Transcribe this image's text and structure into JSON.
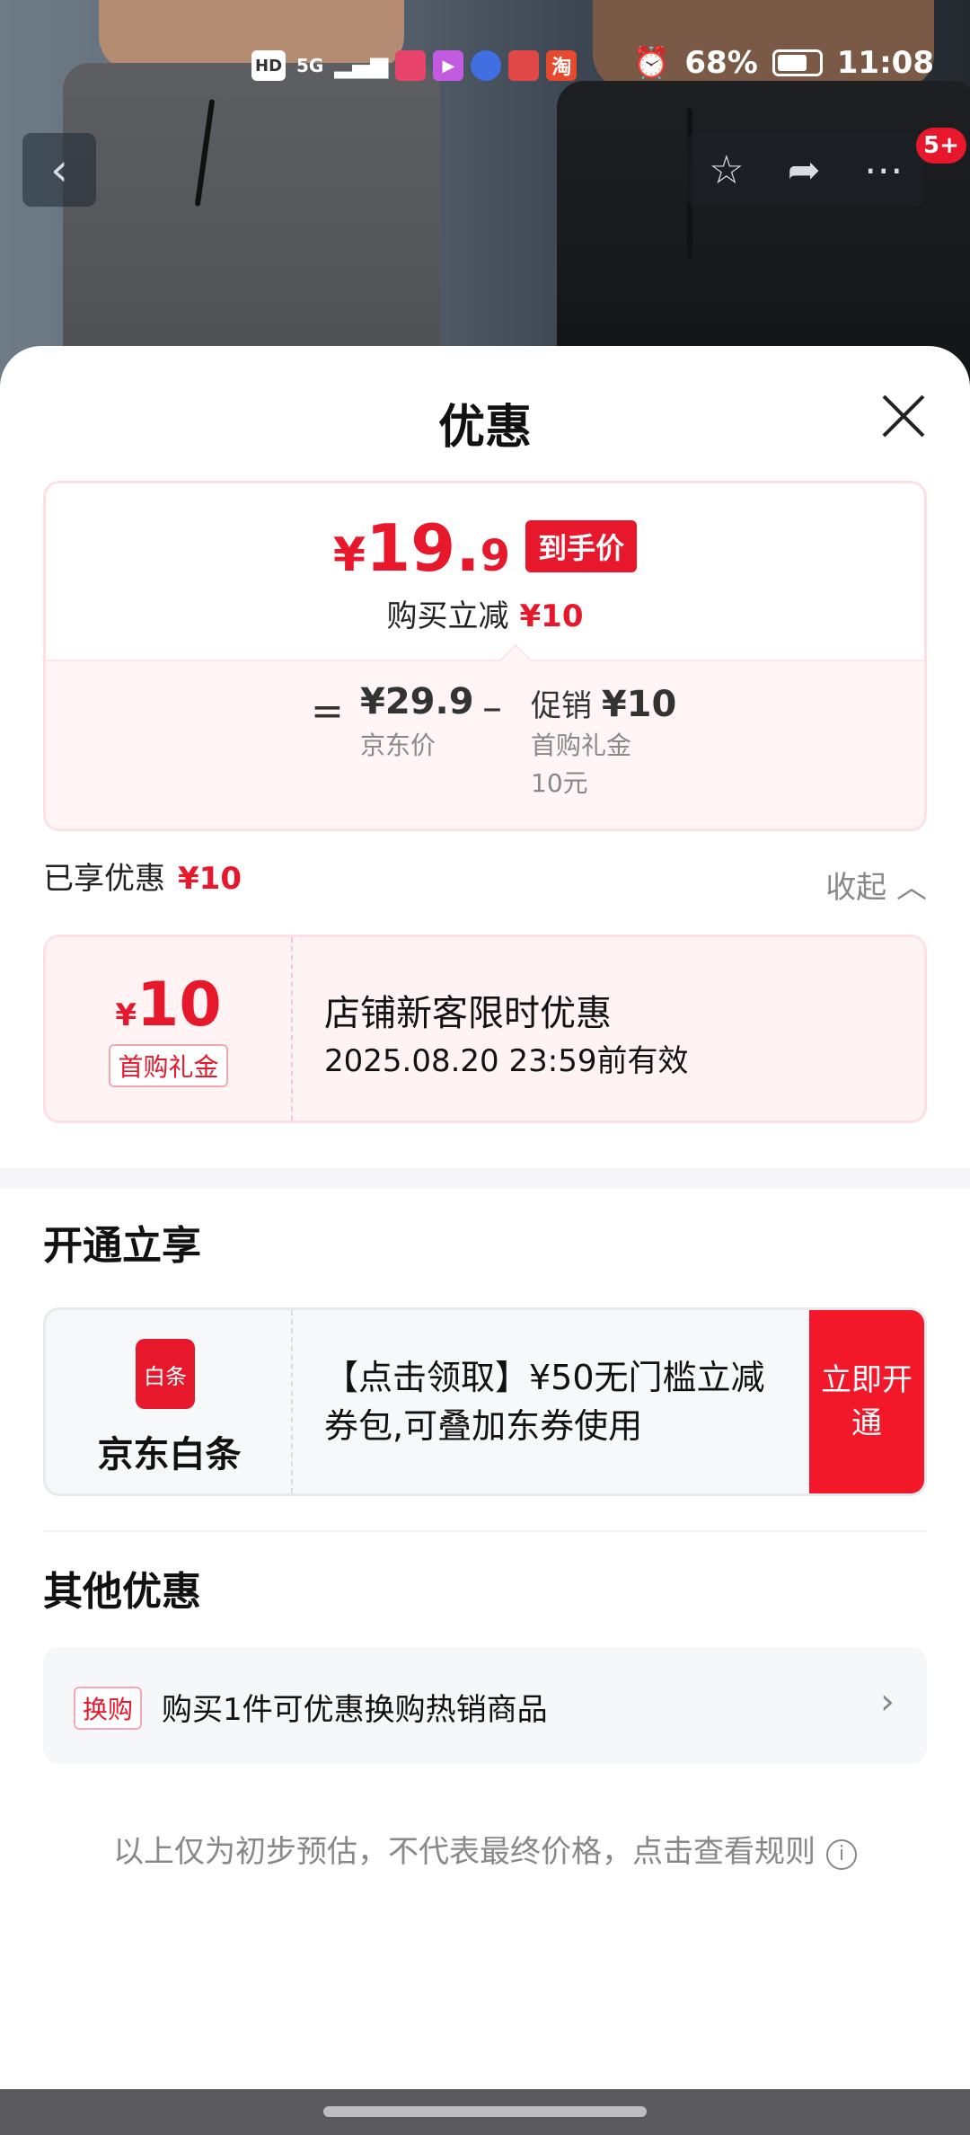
{
  "status_bar": {
    "left_chips": [
      "HD",
      "5G"
    ],
    "battery": "68%",
    "time": "11:08"
  },
  "nav": {
    "badge": "5+"
  },
  "sheet": {
    "title": "优惠"
  },
  "price": {
    "yen": "¥",
    "integer": "19.",
    "decimal": "9",
    "tag": "到手价",
    "reduce_label": "购买立减",
    "reduce_value": "¥10",
    "equals": "=",
    "base_value": "¥29.9",
    "base_label": "京东价",
    "minus": "–",
    "promo_prefix": "促销",
    "promo_value": "¥10",
    "promo_detail_1": "首购礼金",
    "promo_detail_2": "10元"
  },
  "enjoyed": {
    "label": "已享优惠",
    "value": "¥10",
    "collapse": "收起"
  },
  "coupon": {
    "yen": "¥",
    "amount": "10",
    "type": "首购礼金",
    "title": "店铺新客限时优惠",
    "valid": "2025.08.20 23:59前有效"
  },
  "section_open": {
    "title": "开通立享",
    "card": {
      "icon_text": "白条",
      "name": "京东白条",
      "desc": "【点击领取】¥50无门槛立减券包,可叠加东券使用",
      "button": "立即开通"
    }
  },
  "section_other": {
    "title": "其他优惠",
    "row": {
      "tag": "换购",
      "text": "购买1件可优惠换购热销商品"
    }
  },
  "note": {
    "text": "以上仅为初步预估，不代表最终价格，点击查看规则"
  },
  "colors": {
    "accent_red": "#e8182c",
    "button_red": "#f2182a"
  },
  "icons": [
    "back-arrow-icon",
    "star-icon",
    "share-icon",
    "more-icon",
    "close-icon",
    "chevron-up-icon",
    "chevron-right-icon",
    "info-icon",
    "alarm-icon",
    "battery-icon"
  ]
}
